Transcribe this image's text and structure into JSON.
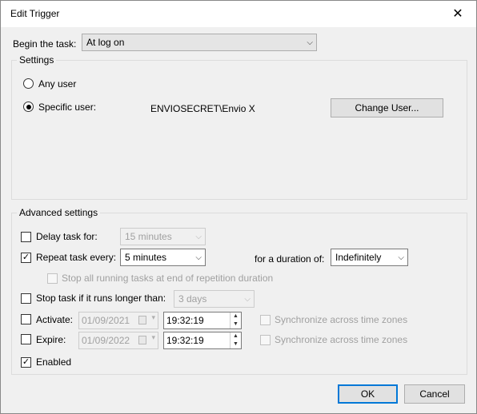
{
  "window": {
    "title": "Edit Trigger",
    "close_glyph": "✕"
  },
  "begin": {
    "label": "Begin the task:",
    "value": "At log on"
  },
  "settings": {
    "legend": "Settings",
    "any_user_label": "Any user",
    "specific_user_label": "Specific user:",
    "user_value": "ENVIOSECRET\\Envio X",
    "change_user_label": "Change User...",
    "selected": "specific"
  },
  "advanced": {
    "legend": "Advanced settings",
    "delay": {
      "label": "Delay task for:",
      "checked": false,
      "value": "15 minutes"
    },
    "repeat": {
      "label": "Repeat task every:",
      "checked": true,
      "value": "5 minutes",
      "duration_label": "for a duration of:",
      "duration_value": "Indefinitely"
    },
    "stop_all": {
      "label": "Stop all running tasks at end of repetition duration",
      "checked": false
    },
    "stop_longer": {
      "label": "Stop task if it runs longer than:",
      "checked": false,
      "value": "3 days"
    },
    "activate": {
      "label": "Activate:",
      "checked": false,
      "date": "01/09/2021",
      "time": "19:32:19",
      "sync_label": "Synchronize across time zones"
    },
    "expire": {
      "label": "Expire:",
      "checked": false,
      "date": "01/09/2022",
      "time": "19:32:19",
      "sync_label": "Synchronize across time zones"
    },
    "enabled": {
      "label": "Enabled",
      "checked": true
    }
  },
  "buttons": {
    "ok": "OK",
    "cancel": "Cancel"
  },
  "glyphs": {
    "check": "✓",
    "combo_arrow": "⌵",
    "spin_up": "▲",
    "spin_down": "▼",
    "date_dropdown": "▾"
  }
}
